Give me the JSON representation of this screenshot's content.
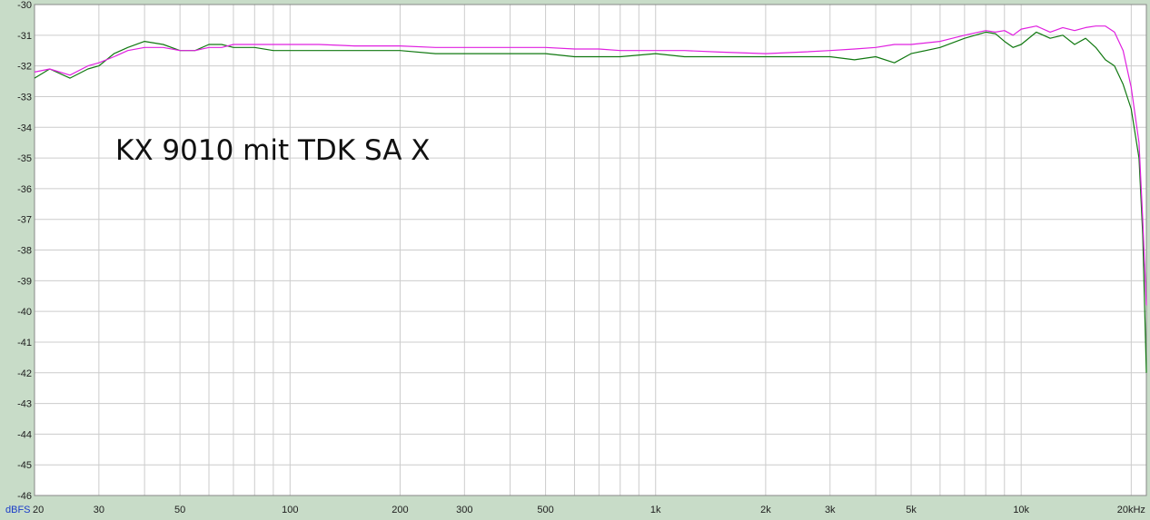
{
  "chart_data": {
    "type": "line",
    "title": "",
    "annotation": "KX 9010  mit  TDK SA X",
    "xlabel": "",
    "ylabel": "",
    "y_unit_label": "dBFS",
    "x_scale": "log",
    "xlim": [
      20,
      22000
    ],
    "ylim": [
      -46,
      -30
    ],
    "x_tick_labels": [
      {
        "value": 20,
        "label": "20"
      },
      {
        "value": 30,
        "label": "30"
      },
      {
        "value": 50,
        "label": "50"
      },
      {
        "value": 100,
        "label": "100"
      },
      {
        "value": 200,
        "label": "200"
      },
      {
        "value": 300,
        "label": "300"
      },
      {
        "value": 500,
        "label": "500"
      },
      {
        "value": 1000,
        "label": "1k"
      },
      {
        "value": 2000,
        "label": "2k"
      },
      {
        "value": 3000,
        "label": "3k"
      },
      {
        "value": 5000,
        "label": "5k"
      },
      {
        "value": 10000,
        "label": "10k"
      },
      {
        "value": 20000,
        "label": "20kHz"
      }
    ],
    "y_tick_labels": [
      "-30",
      "-31",
      "-32",
      "-33",
      "-34",
      "-35",
      "-36",
      "-37",
      "-38",
      "-39",
      "-40",
      "-41",
      "-42",
      "-43",
      "-44",
      "-45",
      "-46"
    ],
    "grid": true,
    "colors": {
      "background": "#ffffff",
      "frame": "#c8dcc8",
      "grid": "#cccccc",
      "series_green": "#107810",
      "series_magenta": "#e020e0"
    },
    "series": [
      {
        "color": "#107810",
        "x": [
          20,
          22,
          25,
          28,
          30,
          33,
          36,
          40,
          45,
          50,
          55,
          60,
          65,
          70,
          80,
          90,
          100,
          120,
          150,
          200,
          250,
          300,
          400,
          500,
          600,
          700,
          800,
          1000,
          1200,
          1500,
          2000,
          2500,
          3000,
          3500,
          4000,
          4500,
          5000,
          6000,
          7000,
          8000,
          8500,
          9000,
          9500,
          10000,
          11000,
          12000,
          13000,
          14000,
          15000,
          16000,
          17000,
          18000,
          19000,
          20000,
          21000,
          21500,
          22000
        ],
        "y": [
          -32.4,
          -32.1,
          -32.4,
          -32.1,
          -32.0,
          -31.6,
          -31.4,
          -31.2,
          -31.3,
          -31.5,
          -31.5,
          -31.3,
          -31.3,
          -31.4,
          -31.4,
          -31.5,
          -31.5,
          -31.5,
          -31.5,
          -31.5,
          -31.6,
          -31.6,
          -31.6,
          -31.6,
          -31.7,
          -31.7,
          -31.7,
          -31.6,
          -31.7,
          -31.7,
          -31.7,
          -31.7,
          -31.7,
          -31.8,
          -31.7,
          -31.9,
          -31.6,
          -31.4,
          -31.1,
          -30.9,
          -30.95,
          -31.2,
          -31.4,
          -31.3,
          -30.9,
          -31.1,
          -31.0,
          -31.3,
          -31.1,
          -31.4,
          -31.8,
          -32.0,
          -32.6,
          -33.4,
          -35.0,
          -37.5,
          -42.0
        ]
      },
      {
        "color": "#e020e0",
        "x": [
          20,
          22,
          25,
          28,
          30,
          33,
          36,
          40,
          45,
          50,
          55,
          60,
          65,
          70,
          80,
          90,
          100,
          120,
          150,
          200,
          250,
          300,
          400,
          500,
          600,
          700,
          800,
          1000,
          1200,
          1500,
          2000,
          2500,
          3000,
          3500,
          4000,
          4500,
          5000,
          6000,
          7000,
          8000,
          8500,
          9000,
          9500,
          10000,
          11000,
          12000,
          13000,
          14000,
          15000,
          16000,
          17000,
          18000,
          19000,
          20000,
          21000,
          21500,
          22000
        ],
        "y": [
          -32.2,
          -32.1,
          -32.3,
          -32.0,
          -31.9,
          -31.7,
          -31.5,
          -31.4,
          -31.4,
          -31.5,
          -31.5,
          -31.4,
          -31.4,
          -31.3,
          -31.3,
          -31.3,
          -31.3,
          -31.3,
          -31.35,
          -31.35,
          -31.4,
          -31.4,
          -31.4,
          -31.4,
          -31.45,
          -31.45,
          -31.5,
          -31.5,
          -31.5,
          -31.55,
          -31.6,
          -31.55,
          -31.5,
          -31.45,
          -31.4,
          -31.3,
          -31.3,
          -31.2,
          -31.0,
          -30.85,
          -30.9,
          -30.85,
          -31.0,
          -30.8,
          -30.7,
          -30.9,
          -30.75,
          -30.85,
          -30.75,
          -30.7,
          -30.7,
          -30.9,
          -31.5,
          -32.7,
          -34.5,
          -37.0,
          -39.8
        ]
      }
    ]
  }
}
